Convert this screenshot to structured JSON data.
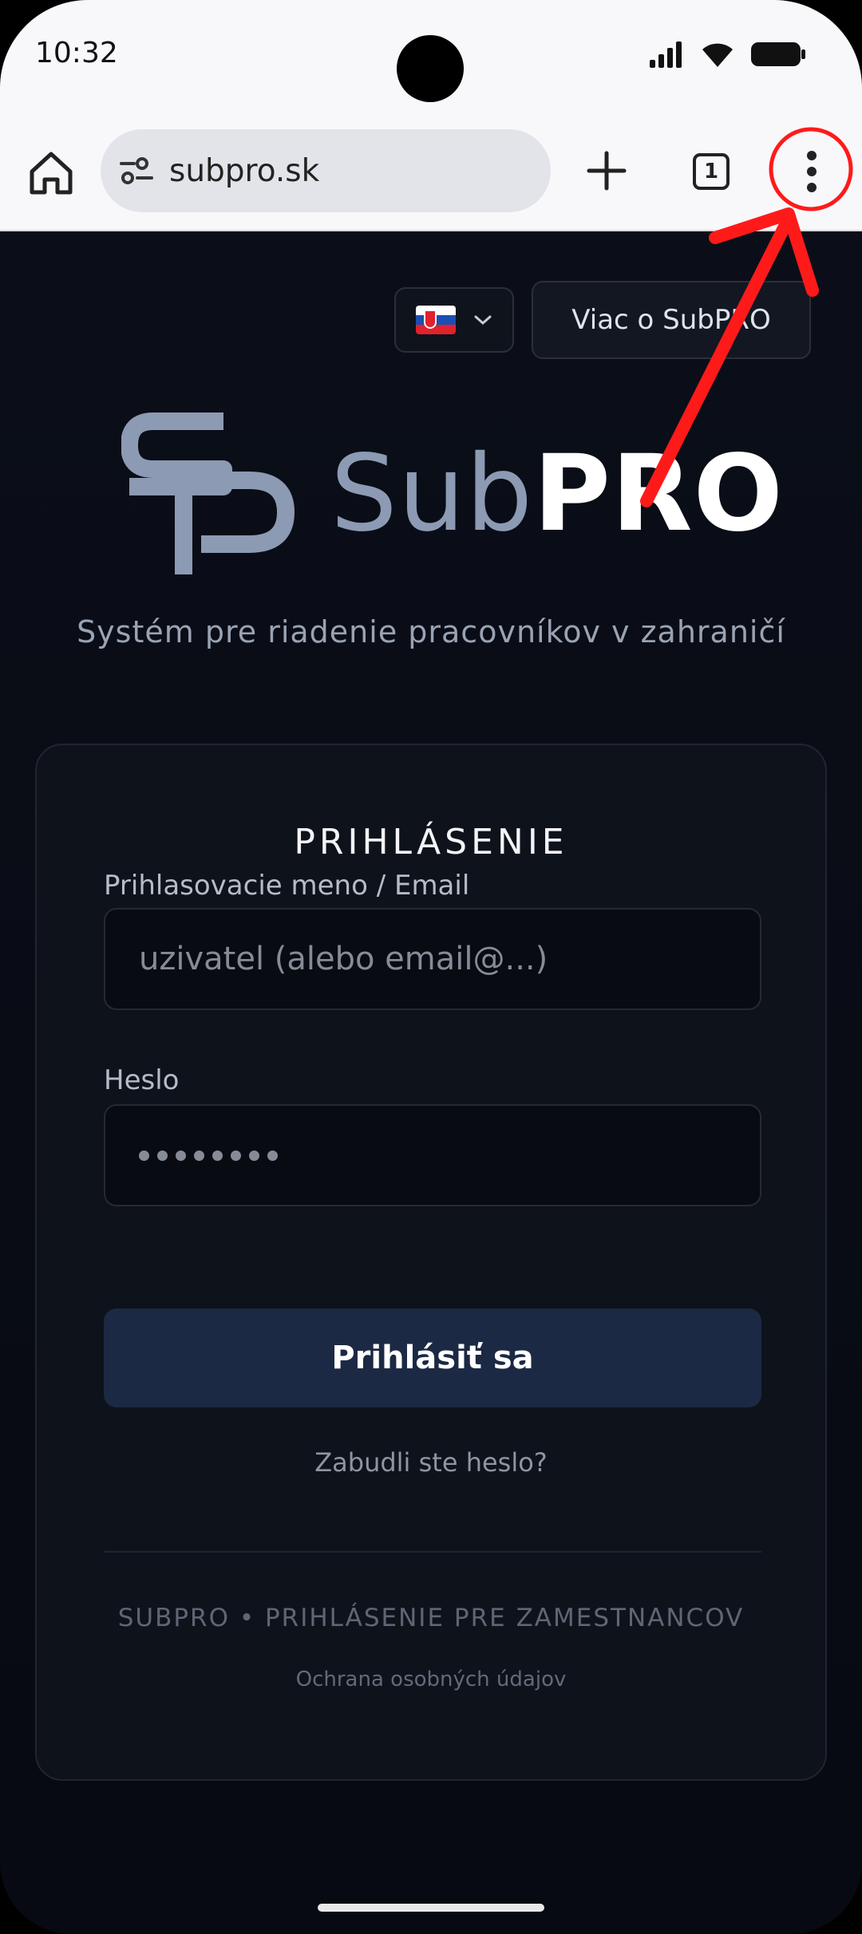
{
  "status_bar": {
    "time": "10:32"
  },
  "browser": {
    "url": "subpro.sk",
    "tab_count": "1",
    "icons": [
      "home-icon",
      "site-settings-icon",
      "new-tab-icon",
      "tab-switcher-icon",
      "more-vert-icon"
    ]
  },
  "header": {
    "language": "Slovenčina",
    "about_label": "Viac o SubPRO"
  },
  "logo": {
    "text_sub": "Sub",
    "text_pro": "PRO",
    "brand_color": "#8c9ab3"
  },
  "tagline": "Systém pre riadenie pracovníkov v zahraničí",
  "login": {
    "title": "PRIHLÁSENIE",
    "username_label": "Prihlasovacie meno / Email",
    "username_placeholder": "uzivatel (alebo email@...)",
    "password_label": "Heslo",
    "password_masked": "••••••••",
    "submit_label": "Prihlásiť sa",
    "forgot_label": "Zabudli ste heslo?",
    "footer_caption": "SUBPRO • PRIHLÁSENIE PRE ZAMESTNANCOV",
    "privacy_label": "Ochrana osobných údajov"
  },
  "annotation": {
    "color": "#ff1a1a"
  }
}
